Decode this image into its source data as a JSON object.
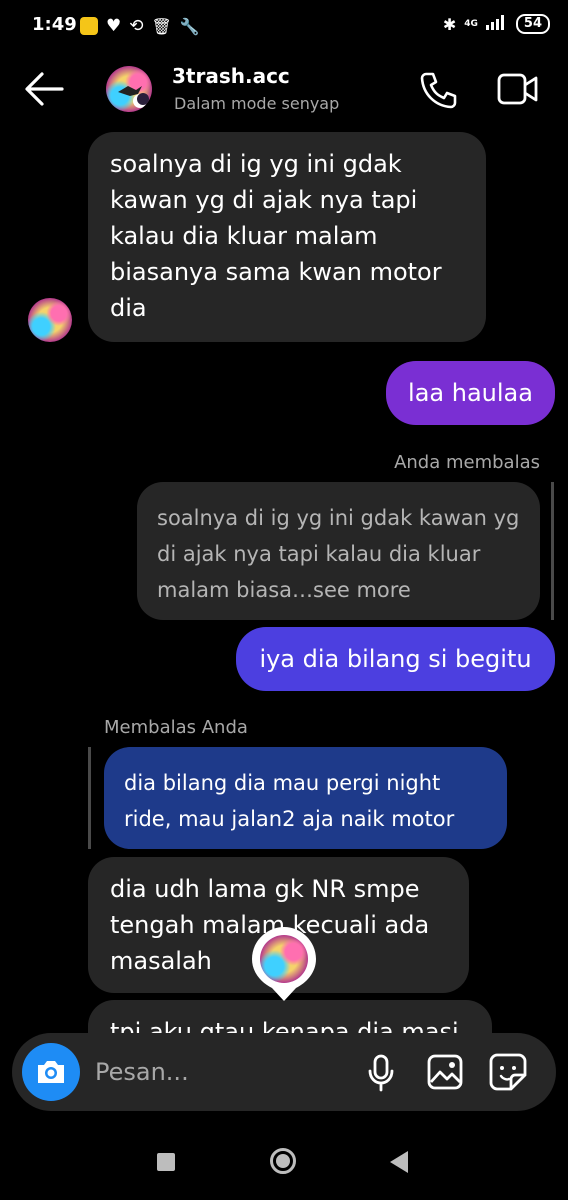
{
  "status": {
    "time": "1:49",
    "network": "4G",
    "battery": "54"
  },
  "header": {
    "title": "3trash.acc",
    "subtitle": "Dalam mode senyap"
  },
  "messages": {
    "m1": "soalnya di ig yg ini gdak kawan yg di ajak nya tapi kalau dia kluar malam biasanya sama kwan motor dia",
    "m2": "laa haulaa",
    "reply1_label": "Anda membalas",
    "reply1_quote": "soalnya di ig yg ini gdak kawan yg di ajak nya tapi kalau dia kluar malam biasa…see more",
    "m3": "iya dia bilang si begitu",
    "reply2_label": "Membalas Anda",
    "reply2_quote": "dia bilang dia mau pergi night ride, mau jalan2 aja naik motor",
    "m4": "dia udh lama gk NR smpe tengah malam kecuali ada masalah",
    "m5_partial": "tpi aku gtau kenapa dia masi"
  },
  "composer": {
    "placeholder": "Pesan..."
  },
  "icons": {
    "back": "back-arrow-icon",
    "call": "phone-icon",
    "video": "video-camera-icon",
    "camera": "camera-icon",
    "mic": "microphone-icon",
    "gallery": "gallery-icon",
    "sticker": "sticker-icon"
  },
  "colors": {
    "purple_bubble": "#7a2fd3",
    "blue_bubble": "#4c3fe0",
    "quote_blue": "#1e3a8a",
    "camera_blue": "#1e8cf5"
  }
}
